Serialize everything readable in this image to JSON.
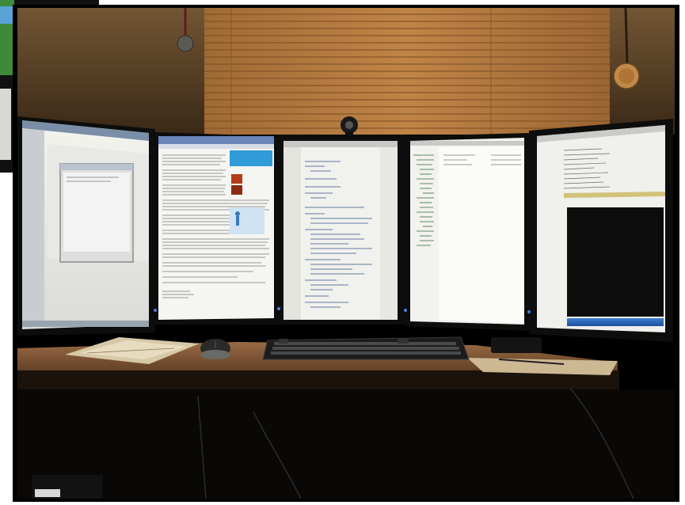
{
  "scene": {
    "colors": {
      "frame": "#000000",
      "wall": "#6b4a2a",
      "blinds": "#b0773d",
      "desk": "#8a5c3a",
      "screen_glow": "#f1f1ec",
      "accent_blue": "#2a5fb2"
    },
    "monitors": [
      {
        "name": "left-monitor"
      },
      {
        "name": "center-left-monitor"
      },
      {
        "name": "center-monitor"
      },
      {
        "name": "center-right-monitor"
      },
      {
        "name": "right-monitor"
      }
    ]
  }
}
